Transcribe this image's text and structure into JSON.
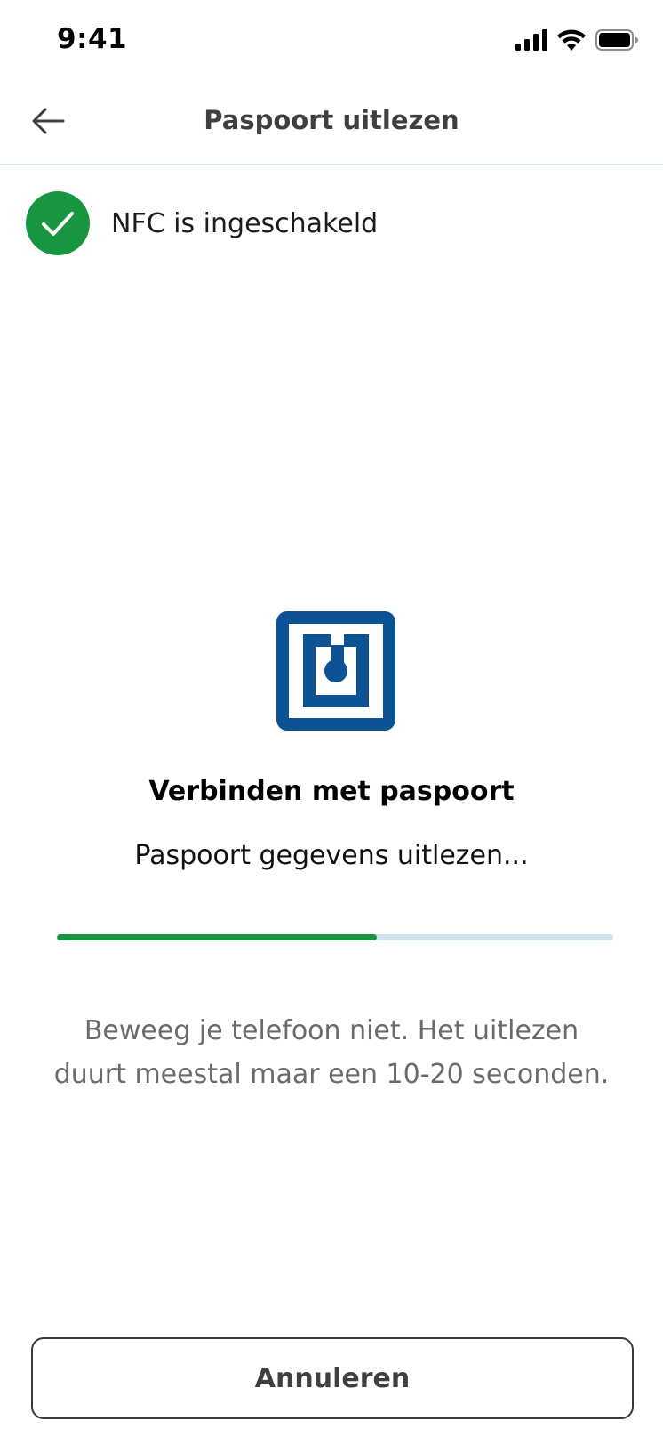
{
  "status_bar": {
    "time": "9:41",
    "icons": [
      "cellular-signal-icon",
      "wifi-icon",
      "battery-icon"
    ]
  },
  "header": {
    "title": "Paspoort uitlezen",
    "back_icon": "arrow-left-icon"
  },
  "nfc_status": {
    "icon": "check-circle-icon",
    "label": "NFC is ingeschakeld"
  },
  "main": {
    "logo_icon": "nfc-logo-icon",
    "title": "Verbinden met paspoort",
    "status": "Paspoort gegevens uitlezen...",
    "progress_fraction": 0.575,
    "hint": "Beweeg je telefoon niet. Het uitlezen duurt meestal maar een 10-20 seconden."
  },
  "footer": {
    "cancel_label": "Annuleren"
  },
  "colors": {
    "success_green": "#17963f",
    "nfc_blue": "#0b5394",
    "progress_track": "#cfe2ee",
    "divider": "#d6e2ea",
    "hint_gray": "#6b6b6b"
  }
}
